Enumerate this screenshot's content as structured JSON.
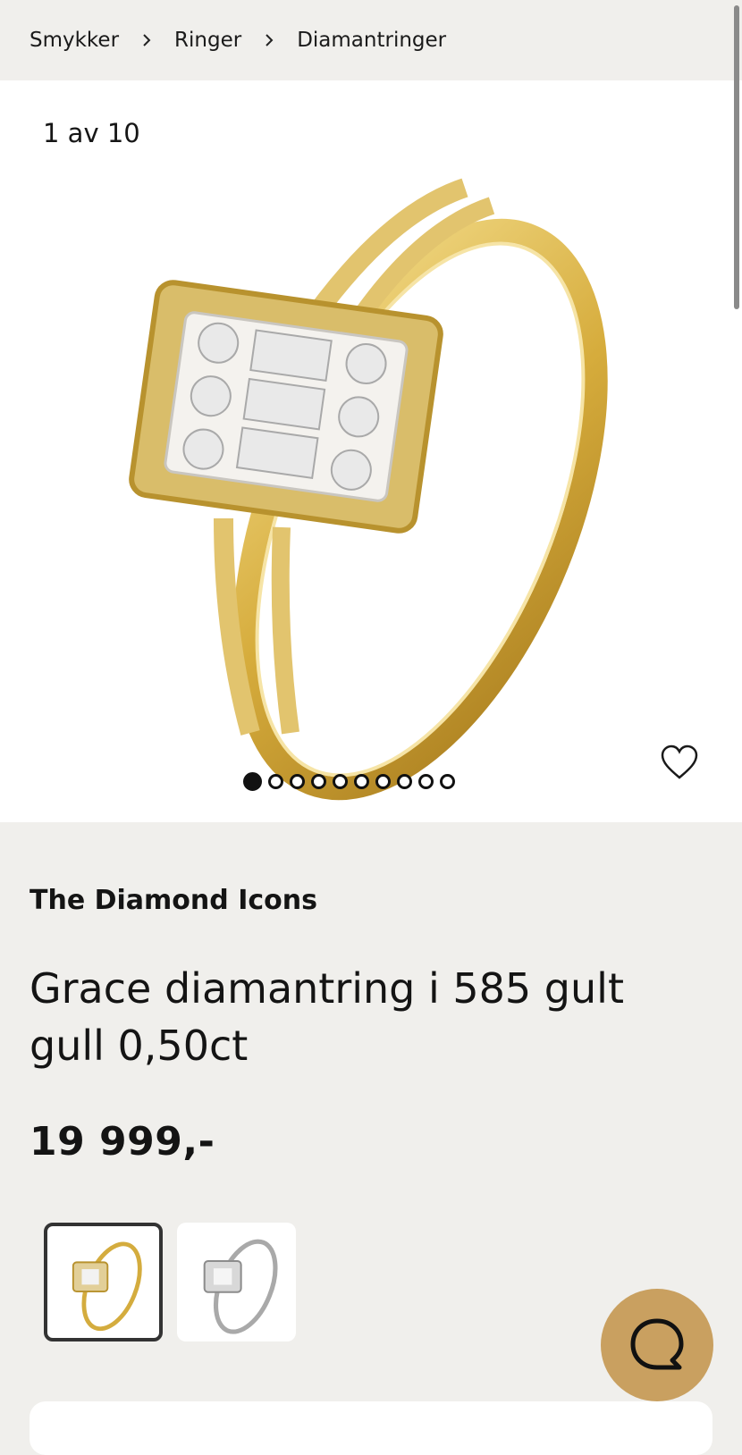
{
  "breadcrumb": {
    "items": [
      {
        "label": "Smykker"
      },
      {
        "label": "Ringer"
      },
      {
        "label": "Diamantringer"
      }
    ]
  },
  "gallery": {
    "counter": "1 av 10",
    "total_images": 10,
    "active_index": 0,
    "favorite_icon": "heart-icon"
  },
  "product": {
    "brand": "The Diamond Icons",
    "title": "Grace diamantring i 585 gult gull 0,50ct",
    "price": "19 999,-"
  },
  "variants": [
    {
      "name": "gult gull",
      "selected": true
    },
    {
      "name": "hvitt gull",
      "selected": false
    }
  ],
  "chat": {
    "icon": "chat-bubble-icon",
    "color": "#c9a060"
  },
  "colors": {
    "background": "#f0efec",
    "accent": "#c9a060",
    "gold": "#d4b04a"
  }
}
